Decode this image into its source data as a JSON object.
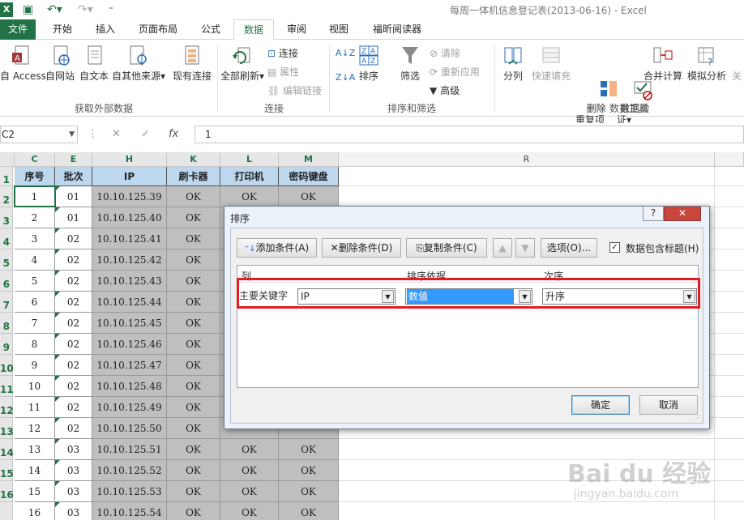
{
  "window": {
    "title": "每周一体机信息登记表(2013-06-16) - Excel",
    "logo_text": "X"
  },
  "tabs": [
    "文件",
    "开始",
    "插入",
    "页面布局",
    "公式",
    "数据",
    "审阅",
    "视图",
    "福昕阅读器"
  ],
  "active_tab": "数据",
  "ribbon": {
    "get_external": {
      "items": [
        "自 Access",
        "自网站",
        "自文本",
        "自其他来源",
        "现有连接"
      ],
      "label": "获取外部数据"
    },
    "connections": {
      "refresh_all": "全部刷新",
      "small": [
        "连接",
        "属性",
        "编辑链接"
      ],
      "label": "连接"
    },
    "sort_filter": {
      "sort": "排序",
      "filter": "筛选",
      "small": [
        "清除",
        "重新应用",
        "高级"
      ],
      "label": "排序和筛选"
    },
    "data_tools": {
      "items": [
        "分列",
        "快速填充",
        "删除\n重复项",
        "数据验\n证",
        "合并计算",
        "模拟分析",
        "关"
      ],
      "label": "数据工具"
    }
  },
  "formula_bar": {
    "name_box": "C2",
    "fx": "fx",
    "value": "1"
  },
  "sheet": {
    "col_headers": [
      "C",
      "E",
      "H",
      "K",
      "L",
      "M",
      "R"
    ],
    "row_headers": [
      "1",
      "2",
      "3",
      "4",
      "5",
      "6",
      "7",
      "8",
      "9",
      "10",
      "11",
      "12",
      "13",
      "14",
      "15",
      "16"
    ],
    "table_headers": [
      "序号",
      "批次",
      "IP",
      "刷卡器",
      "打印机",
      "密码键盘"
    ],
    "rows": [
      [
        "1",
        "01",
        "10.10.125.39",
        "OK",
        "OK",
        "OK"
      ],
      [
        "2",
        "01",
        "10.10.125.40",
        "OK",
        "OK",
        "OK"
      ],
      [
        "3",
        "02",
        "10.10.125.41",
        "OK",
        "",
        ""
      ],
      [
        "4",
        "02",
        "10.10.125.42",
        "OK",
        "",
        ""
      ],
      [
        "5",
        "02",
        "10.10.125.43",
        "OK",
        "",
        ""
      ],
      [
        "6",
        "02",
        "10.10.125.44",
        "OK",
        "",
        ""
      ],
      [
        "7",
        "02",
        "10.10.125.45",
        "OK",
        "",
        ""
      ],
      [
        "8",
        "02",
        "10.10.125.46",
        "OK",
        "",
        ""
      ],
      [
        "9",
        "02",
        "10.10.125.47",
        "OK",
        "",
        ""
      ],
      [
        "10",
        "02",
        "10.10.125.48",
        "OK",
        "",
        ""
      ],
      [
        "11",
        "02",
        "10.10.125.49",
        "OK",
        "",
        ""
      ],
      [
        "12",
        "02",
        "10.10.125.50",
        "OK",
        "",
        ""
      ],
      [
        "13",
        "03",
        "10.10.125.51",
        "OK",
        "OK",
        "OK"
      ],
      [
        "14",
        "03",
        "10.10.125.52",
        "OK",
        "OK",
        "OK"
      ],
      [
        "15",
        "03",
        "10.10.125.53",
        "OK",
        "OK",
        "OK"
      ],
      [
        "16",
        "03",
        "10.10.125.54",
        "OK",
        "OK",
        "OK"
      ]
    ]
  },
  "sort_dialog": {
    "title": "排序",
    "help": "?",
    "close": "✕",
    "add_condition": "添加条件(A)",
    "delete_condition": "删除条件(D)",
    "copy_condition": "复制条件(C)",
    "options": "选项(O)...",
    "has_header_label": "数据包含标题(H)",
    "has_header_checked": true,
    "col_header_column": "列",
    "col_header_sort_on": "排序依据",
    "col_header_order": "次序",
    "row_label": "主要关键字",
    "column_value": "IP",
    "sort_on_value": "数值",
    "order_value": "升序",
    "ok": "确定",
    "cancel": "取消"
  },
  "watermark": {
    "logo": "Bai du 经验",
    "url": "jingyan.baidu.com"
  },
  "colors": {
    "excel_green": "#217346",
    "header_fill": "#bdd7ee",
    "gray_fill": "#bfbfbf",
    "highlight": "#e31b23"
  }
}
